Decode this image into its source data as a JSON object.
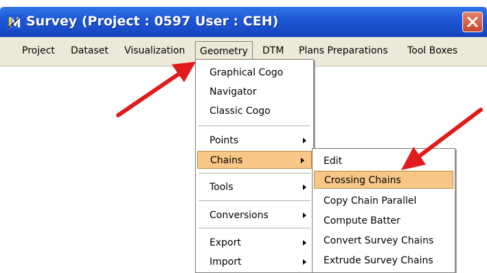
{
  "window": {
    "title": "Survey (Project : 0597   User : CEH)"
  },
  "menubar": {
    "items": [
      {
        "label": "Project"
      },
      {
        "label": "Dataset"
      },
      {
        "label": "Visualization"
      },
      {
        "label": "Geometry"
      },
      {
        "label": "DTM"
      },
      {
        "label": "Plans Preparations"
      },
      {
        "label": "Tool Boxes"
      }
    ]
  },
  "geometry_menu": {
    "items": [
      {
        "label": "Graphical Cogo"
      },
      {
        "label": "Navigator"
      },
      {
        "label": "Classic Cogo"
      },
      {
        "label": "Points"
      },
      {
        "label": "Chains"
      },
      {
        "label": "Tools"
      },
      {
        "label": "Conversions"
      },
      {
        "label": "Export"
      },
      {
        "label": "Import"
      }
    ]
  },
  "chains_menu": {
    "items": [
      {
        "label": "Edit"
      },
      {
        "label": "Crossing Chains"
      },
      {
        "label": "Copy Chain Parallel"
      },
      {
        "label": "Compute Batter"
      },
      {
        "label": "Convert Survey Chains"
      },
      {
        "label": "Extrude Survey Chains"
      }
    ]
  },
  "colors": {
    "titlebar": "#1f58d6",
    "highlight": "#f8c787",
    "annotation_arrow": "#e11b1b",
    "close_button": "#d4573c"
  },
  "icons": [
    "app-logo-icon",
    "close-icon",
    "submenu-arrow-icon",
    "annotation-arrow-icon"
  ]
}
